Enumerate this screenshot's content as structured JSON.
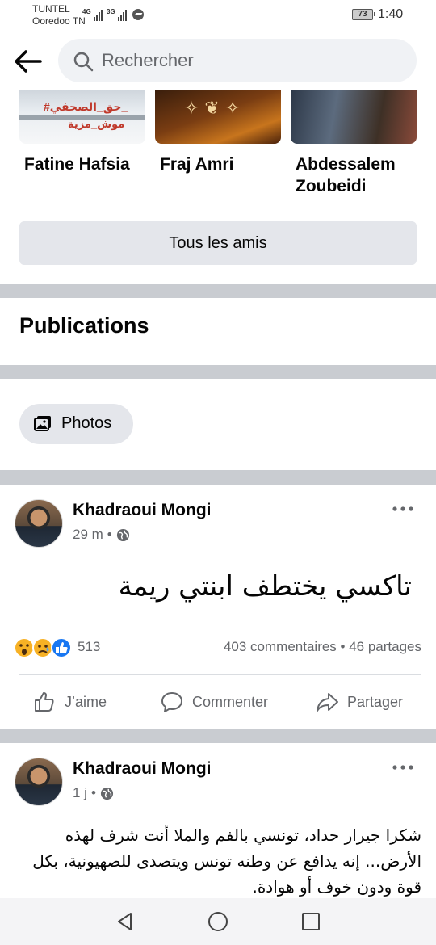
{
  "status_bar": {
    "carrier_primary": "TUNTEL",
    "carrier_secondary": "Ooredoo TN",
    "net1": "4G",
    "net2": "3G",
    "battery": "73",
    "time": "1:40"
  },
  "search": {
    "placeholder": "Rechercher"
  },
  "friends": {
    "items": [
      {
        "name": "Fatine Hafsia",
        "image_caption_1": "#حق_الصحفي_",
        "image_caption_2": "موش_مزية"
      },
      {
        "name": "Fraj Amri"
      },
      {
        "name": "Abdessalem Zoubeidi"
      }
    ],
    "all_friends_label": "Tous les amis"
  },
  "publications": {
    "title": "Publications"
  },
  "photos_chip": {
    "label": "Photos",
    "icon": "photo-icon"
  },
  "posts": [
    {
      "author": "Khadraoui Mongi",
      "time": "29 m",
      "text": "تاكسي يختطف ابنتي ريمة",
      "reactions": [
        "wow",
        "sad",
        "like"
      ],
      "reaction_count": "513",
      "stats": "403 commentaires • 46 partages",
      "actions": {
        "like": "J’aime",
        "comment": "Commenter",
        "share": "Partager"
      }
    },
    {
      "author": "Khadraoui Mongi",
      "time": "1 j",
      "text": "شكرا جيرار حداد، تونسي بالفم والملا أنت شرف لهذه الأرض... إنه يدافع عن وطنه تونس ويتصدى للصهيونية، بكل قوة ودون خوف أو هوادة."
    }
  ],
  "colors": {
    "separator": "#c9ccd1",
    "chip_bg": "#e4e6eb",
    "secondary_text": "#65676b",
    "like_blue": "#1877f2"
  }
}
